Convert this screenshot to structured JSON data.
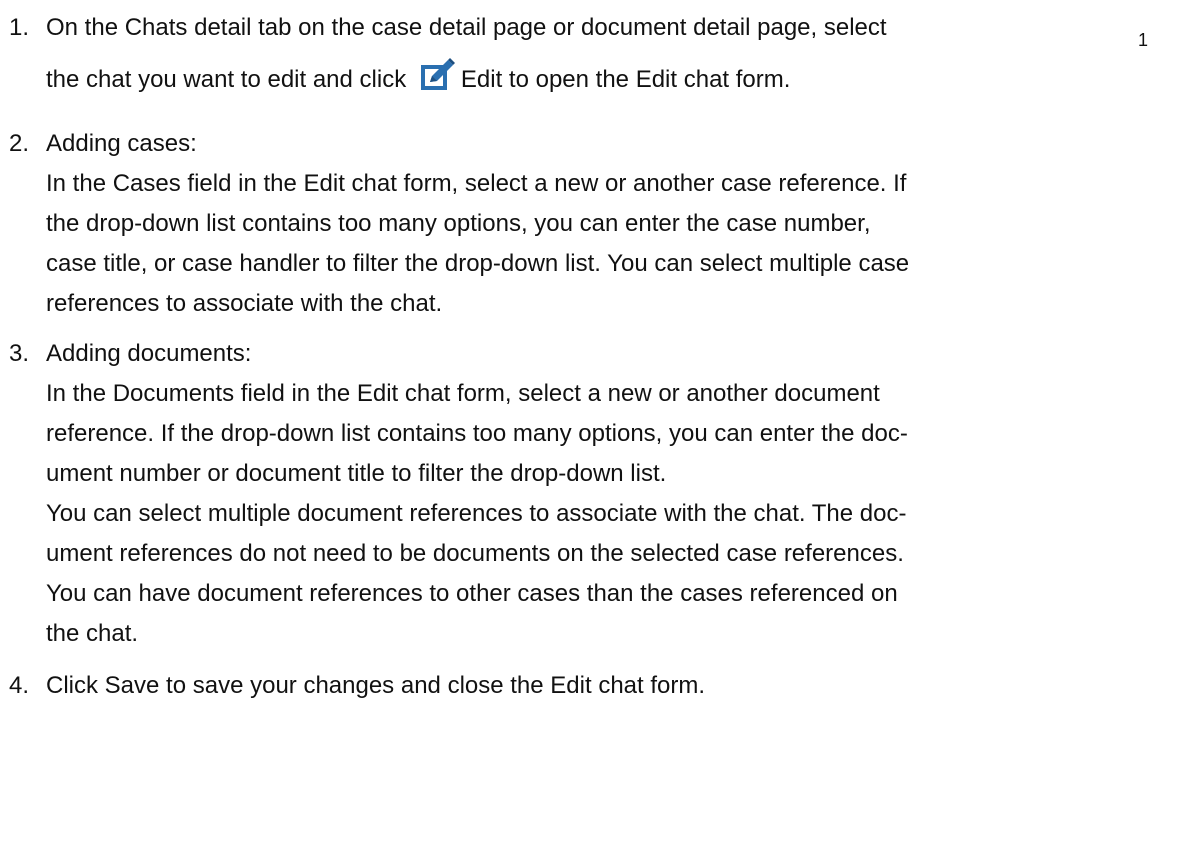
{
  "footnote_marker": "1",
  "steps": [
    {
      "number": "1.",
      "line1": {
        "t1": "On the ",
        "b1": "Chats",
        "t2": " detail tab on the case detail page or document detail page, select"
      },
      "line2": {
        "t1": "the chat you want to edit and click ",
        "icon": "edit-icon",
        "b1": "Edit",
        "t2": " to open the ",
        "b2": "Edit chat",
        "t3": " form."
      }
    },
    {
      "number": "2.",
      "heading": "Adding cases:",
      "para": {
        "l1": {
          "t1": "In the ",
          "b1": "Cases",
          "t2": " field in the ",
          "b2": "Edit chat",
          "t3": " form, select a new or another case reference. If"
        },
        "l2": "the drop-down list contains too many options, you can enter the case number,",
        "l3": "case title, or case handler to filter the drop-down list. You can select multiple case",
        "l4": "references to associate with the chat."
      }
    },
    {
      "number": "3.",
      "heading": "Adding documents:",
      "para": {
        "l1": {
          "t1": "In the ",
          "b1": "Documents",
          "t2": " field in the ",
          "b2": "Edit chat",
          "t3": " form, select a new or another document"
        },
        "l2": "reference. If the drop-down list contains too many options, you can enter the doc-",
        "l3": "ument number or document title to filter the drop-down list.",
        "l4": "You can select multiple document references to associate with the chat. The doc-",
        "l5": "ument references do not need to be documents on the selected case references.",
        "l6": "You can have document references to other cases than the cases referenced on",
        "l7": "the chat."
      }
    },
    {
      "number": "4.",
      "line1": {
        "t1": "Click ",
        "b1": "Save",
        "t2": " to save your changes and close the ",
        "b2": "Edit chat",
        "t3": " form."
      }
    }
  ]
}
